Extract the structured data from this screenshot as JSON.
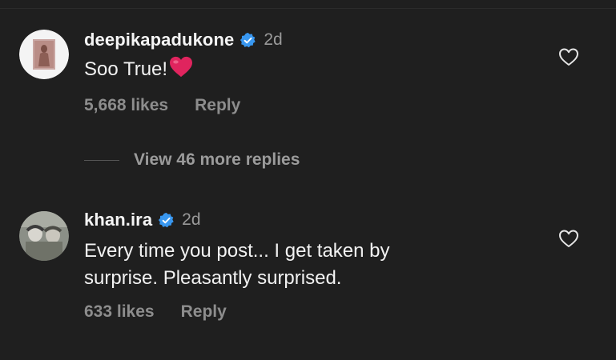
{
  "comments": [
    {
      "username": "deepikapadukone",
      "time": "2d",
      "text": "Soo True!",
      "emoji": "red-heart",
      "likes": "5,668 likes",
      "reply_label": "Reply",
      "verified": true
    },
    {
      "username": "khan.ira",
      "time": "2d",
      "text_line1": "Every time you post... I get taken by",
      "text_line2": "surprise. Pleasantly surprised.",
      "likes": "633 likes",
      "reply_label": "Reply",
      "verified": true
    }
  ],
  "view_replies": {
    "label": "View 46 more replies"
  },
  "colors": {
    "background": "#1f1f1f",
    "verified_blue": "#3897f0",
    "heart_red": "#e0245e",
    "muted_text": "#8d8d8d"
  },
  "icons": [
    "verified-badge-icon",
    "red-heart-emoji-icon",
    "like-heart-outline-icon"
  ]
}
